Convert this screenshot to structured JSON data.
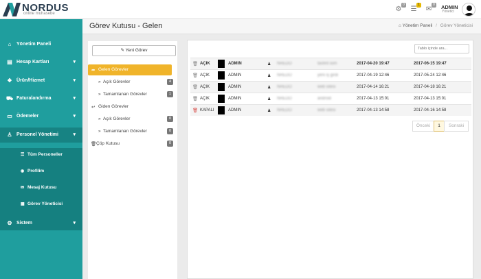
{
  "app": {
    "brand": "NORDUS",
    "brand_sub": "online muhasebe"
  },
  "topbar": {
    "icons": [
      {
        "name": "gear-icon",
        "badge": "0"
      },
      {
        "name": "tasks-icon",
        "badge": "1"
      },
      {
        "name": "mail-icon",
        "badge": "0"
      }
    ],
    "user_name": "ADMIN",
    "user_role": "Yönetici"
  },
  "sidebar": {
    "items": [
      {
        "label": "Yönetim Paneli",
        "icon": "home-icon"
      },
      {
        "label": "Hesap Kartları",
        "icon": "card-icon"
      },
      {
        "label": "Ürün/Hizmet",
        "icon": "box-icon"
      },
      {
        "label": "Faturalandırma",
        "icon": "cart-icon"
      },
      {
        "label": "Ödemeler",
        "icon": "credit-card-icon"
      },
      {
        "label": "Personel Yönetimi",
        "icon": "user-icon"
      },
      {
        "label": "Sistem",
        "icon": "cogs-icon"
      }
    ],
    "sub_items": [
      {
        "label": "Tüm Personeller",
        "icon": "list-icon"
      },
      {
        "label": "Profilim",
        "icon": "circle-user-icon"
      },
      {
        "label": "Mesaj Kutusu",
        "icon": "envelope-icon"
      },
      {
        "label": "Görev Yöneticisi",
        "icon": "list-alt-icon"
      }
    ]
  },
  "page": {
    "title": "Görev Kutusu - Gelen",
    "breadcrumb_home": "Yönetim Paneli",
    "breadcrumb_current": "Görev Yöneticisi"
  },
  "mailbox": {
    "new_button": "Yeni Görev",
    "incoming": "Gelen Görevler",
    "incoming_open": "Açık Görevler",
    "incoming_open_count": "4",
    "incoming_done": "Tamamlanan Görevler",
    "incoming_done_count": "1",
    "outgoing": "Giden Görevler",
    "outgoing_open": "Açık Görevler",
    "outgoing_open_count": "0",
    "outgoing_done": "Tamamlanan Görevler",
    "outgoing_done_count": "0",
    "trash": "Çöp Kutusu",
    "trash_count": "0"
  },
  "list": {
    "search_placeholder": "Tablo içinde ara...",
    "rows": [
      {
        "status": "AÇIK",
        "from": "ADMIN",
        "person": "NREDO",
        "subject": "tasfirit isim",
        "created": "2017-04-20 19:47",
        "due": "2017-06-15 19:47",
        "bold": true
      },
      {
        "status": "AÇIK",
        "from": "ADMIN",
        "person": "NREDO",
        "subject": "yeni iş girdi",
        "created": "2017-04-19 12:46",
        "due": "2017-05-24 12:46",
        "bold": false
      },
      {
        "status": "AÇIK",
        "from": "ADMIN",
        "person": "NREDO",
        "subject": "web sitesi",
        "created": "2017-04-14 16:21",
        "due": "2017-04-18 16:21",
        "bold": false
      },
      {
        "status": "AÇIK",
        "from": "ADMIN",
        "person": "NREDO",
        "subject": "android",
        "created": "2017-04-13 15:01",
        "due": "2017-04-13 15:01",
        "bold": false
      },
      {
        "status": "KAPALI",
        "from": "ADMIN",
        "person": "NREDO",
        "subject": "web sitesi",
        "created": "2017-04-13 14:58",
        "due": "2017-04-16 14:58",
        "bold": false
      }
    ],
    "pager_prev": "Önceki",
    "pager_current": "1",
    "pager_next": "Sonraki"
  },
  "colors": {
    "sidebar": "#1f9e9e",
    "active_folder": "#f0b42a",
    "closed_status": "#d9534f"
  }
}
